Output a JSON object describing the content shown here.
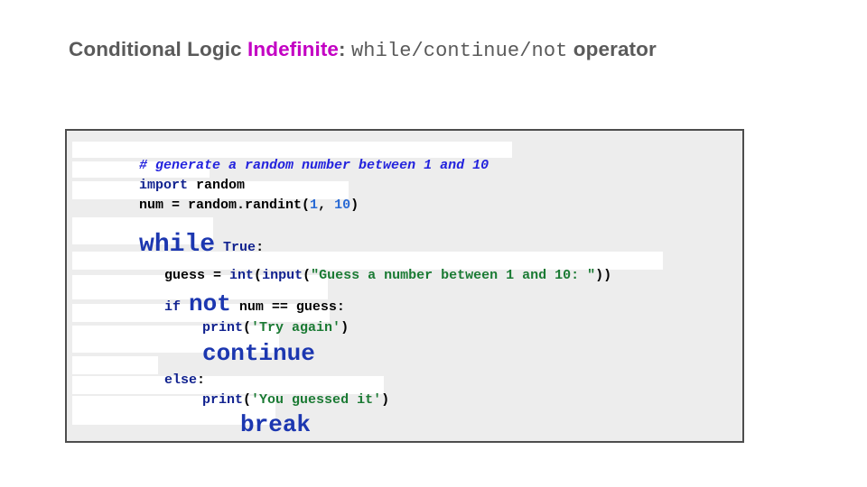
{
  "slide": {
    "title": {
      "prefix": "Conditional Logic ",
      "accent": "Indefinite",
      "colon": ": ",
      "mono": "while/continue/not",
      "suffix": " operator"
    },
    "colors": {
      "title_gray": "#5a5a5a",
      "accent_magenta": "#c300c3",
      "keyword_navy": "#11228f",
      "keyword_blue": "#1c37b0",
      "comment_blue": "#2222dd",
      "string_green": "#1a7a33",
      "number_blue": "#2a6ad4",
      "code_bg": "#ededed",
      "code_border": "#4d4d4d",
      "highlight_band": "#ffffff"
    },
    "code": {
      "language": "python",
      "lines": [
        {
          "id": "comment",
          "text": "# generate a random number between 1 and 10",
          "tokens": [
            {
              "t": "# generate a random number between 1 and 10",
              "c": "comment"
            }
          ]
        },
        {
          "id": "import",
          "text": "import random",
          "tokens": [
            {
              "t": "import",
              "c": "kw"
            },
            {
              "t": " random",
              "c": "black"
            }
          ]
        },
        {
          "id": "num-assign",
          "text": "num = random.randint(1, 10)",
          "tokens": [
            {
              "t": "num = random.randint(",
              "c": "black"
            },
            {
              "t": "1",
              "c": "num"
            },
            {
              "t": ", ",
              "c": "black"
            },
            {
              "t": "10",
              "c": "num"
            },
            {
              "t": ")",
              "c": "black"
            }
          ]
        },
        {
          "id": "while",
          "text": "while True:",
          "tokens": [
            {
              "t": "while",
              "c": "big"
            },
            {
              "t": "True",
              "c": "kw"
            },
            {
              "t": ":",
              "c": "black"
            }
          ]
        },
        {
          "id": "guess-input",
          "text": "guess = int(input(\"Guess a number between 1 and 10: \"))",
          "tokens": [
            {
              "t": "guess = ",
              "c": "black"
            },
            {
              "t": "int",
              "c": "blue"
            },
            {
              "t": "(",
              "c": "black"
            },
            {
              "t": "input",
              "c": "blue"
            },
            {
              "t": "(",
              "c": "black"
            },
            {
              "t": "\"Guess a number between 1 and 10: \"",
              "c": "str"
            },
            {
              "t": "))",
              "c": "black"
            }
          ]
        },
        {
          "id": "if-not",
          "text": "if not num == guess:",
          "tokens": [
            {
              "t": "if",
              "c": "kw"
            },
            {
              "t": "not",
              "c": "big"
            },
            {
              "t": "num == guess:",
              "c": "black"
            }
          ]
        },
        {
          "id": "print-try-again",
          "text": "print('Try again')",
          "tokens": [
            {
              "t": "print",
              "c": "kw"
            },
            {
              "t": "(",
              "c": "black"
            },
            {
              "t": "'Try again'",
              "c": "str"
            },
            {
              "t": ")",
              "c": "black"
            }
          ]
        },
        {
          "id": "continue",
          "text": "continue",
          "tokens": [
            {
              "t": "continue",
              "c": "big"
            }
          ]
        },
        {
          "id": "else",
          "text": "else:",
          "tokens": [
            {
              "t": "else",
              "c": "kw"
            },
            {
              "t": ":",
              "c": "black"
            }
          ]
        },
        {
          "id": "print-you-guessed-it",
          "text": "print('You guessed it')",
          "tokens": [
            {
              "t": "print",
              "c": "kw"
            },
            {
              "t": "(",
              "c": "black"
            },
            {
              "t": "'You guessed it'",
              "c": "str"
            },
            {
              "t": ")",
              "c": "black"
            }
          ]
        },
        {
          "id": "break",
          "text": "break",
          "tokens": [
            {
              "t": "break",
              "c": "big"
            }
          ]
        }
      ]
    }
  }
}
